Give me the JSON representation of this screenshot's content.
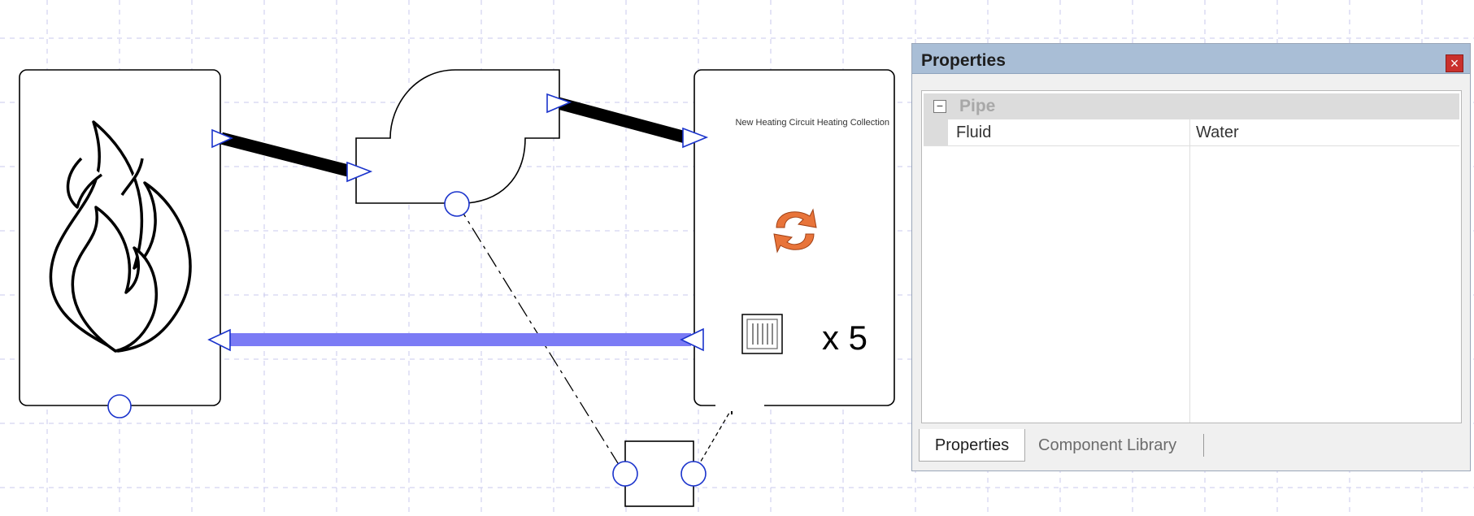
{
  "canvas": {
    "heating_circuit_label": "New Heating Circuit Heating Collection",
    "multiplier_label": "x 5"
  },
  "properties_panel": {
    "title": "Properties",
    "close_glyph": "×",
    "category": {
      "toggle_glyph": "−",
      "label": "Pipe"
    },
    "rows": [
      {
        "name": "Fluid",
        "value": "Water"
      }
    ],
    "tabs": [
      "Properties",
      "Component Library"
    ]
  },
  "colors": {
    "grid": "#c9c9ee",
    "port": "#1a33cc",
    "return_pipe": "#7b7bf5",
    "titlebar": "#a9bed6",
    "close_button": "#c9302c"
  },
  "icons": [
    "flame-icon",
    "refresh-icon",
    "radiator-icon",
    "close-icon",
    "collapse-icon"
  ]
}
